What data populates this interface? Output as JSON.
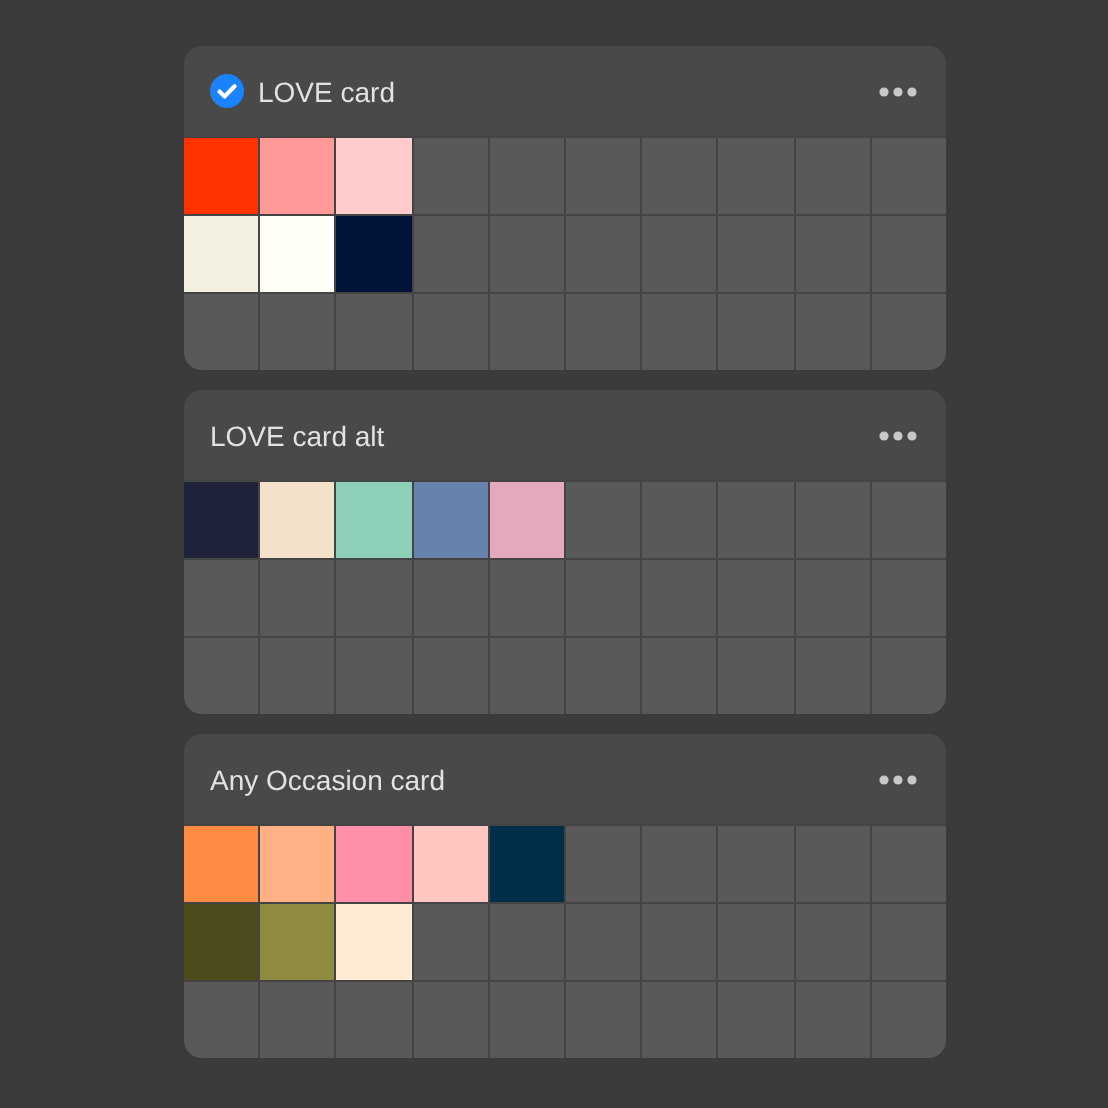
{
  "palettes": [
    {
      "name": "LOVE card",
      "selected": true,
      "rows": [
        [
          {
            "color": "#ff3300"
          },
          {
            "color": "#ff9a98"
          },
          {
            "color": "#ffcccb"
          }
        ],
        [
          {
            "color": "#f3f0df"
          },
          {
            "color": "#fffff8"
          },
          {
            "color": "#00143a"
          }
        ]
      ]
    },
    {
      "name": "LOVE card alt",
      "selected": false,
      "rows": [
        [
          {
            "color": "#1e233a"
          },
          {
            "color": "#f4e1ca"
          },
          {
            "color": "#8ecfb8"
          },
          {
            "color": "#6783ab"
          },
          {
            "color": "#e5a9bf"
          }
        ]
      ]
    },
    {
      "name": "Any Occasion card",
      "selected": false,
      "rows": [
        [
          {
            "color": "#ff8b42"
          },
          {
            "color": "#ffb084"
          },
          {
            "color": "#ff8fa6"
          },
          {
            "color": "#ffc6c1"
          },
          {
            "color": "#002d48"
          }
        ],
        [
          {
            "color": "#4d4a1e"
          },
          {
            "color": "#8e8a3f"
          },
          {
            "color": "#ffead4"
          }
        ]
      ]
    }
  ]
}
